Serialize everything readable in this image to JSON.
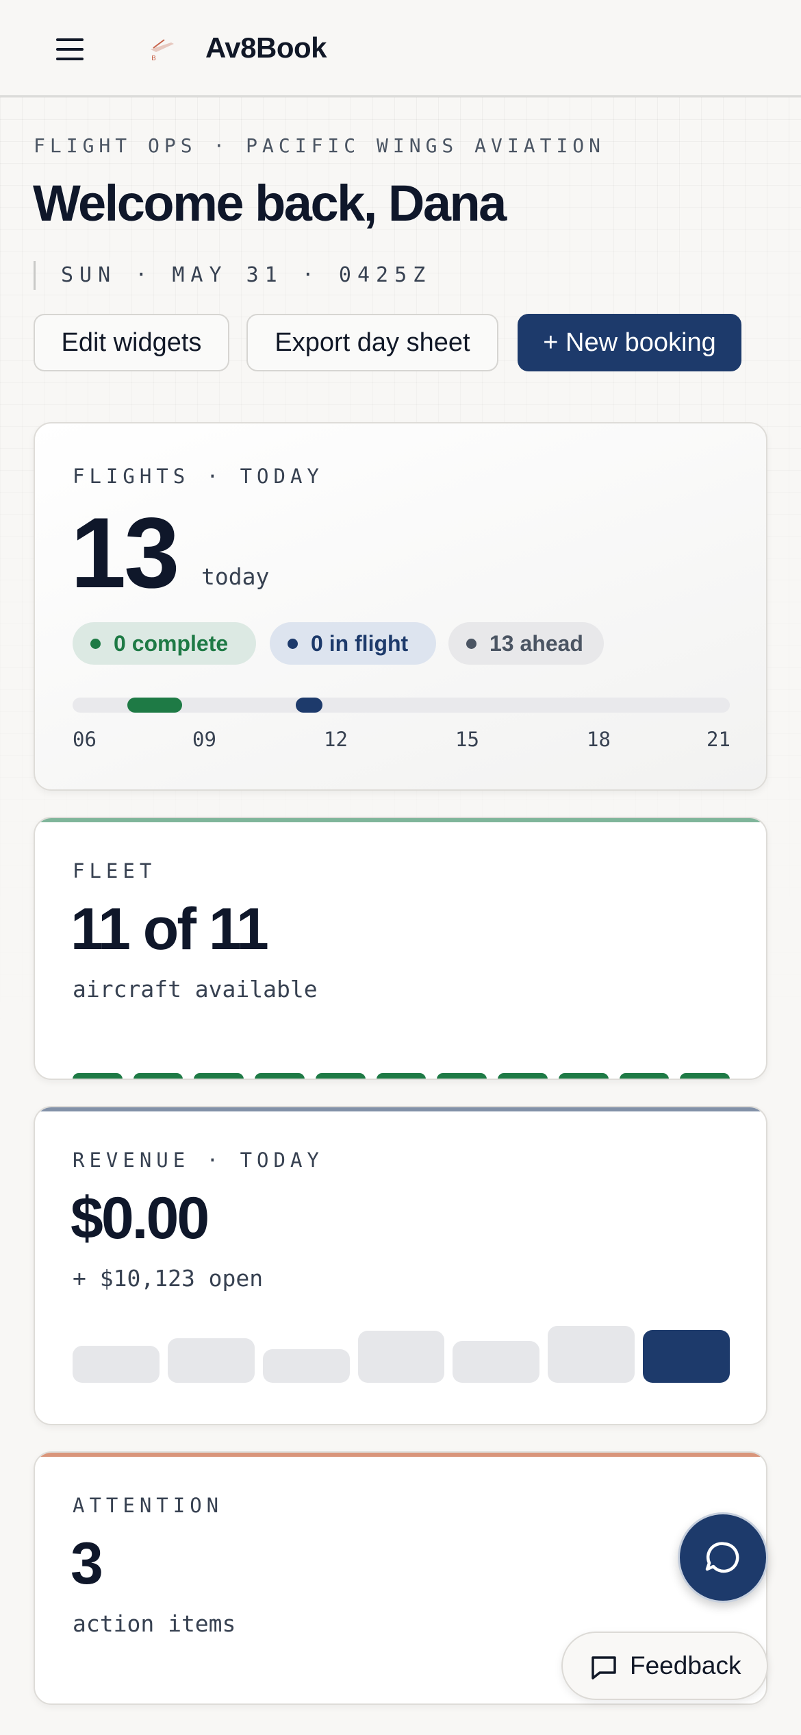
{
  "app": {
    "title": "Av8Book"
  },
  "header": {
    "eyebrow": "FLIGHT OPS · PACIFIC WINGS AVIATION",
    "welcome": "Welcome back, Dana",
    "dateline": "SUN · MAY 31 · 0425Z"
  },
  "actions": {
    "edit_widgets": "Edit widgets",
    "export_day_sheet": "Export day sheet",
    "new_booking": "+ New booking"
  },
  "flights_card": {
    "label": "FLIGHTS · TODAY",
    "count": "13",
    "count_suffix": "today",
    "pills": {
      "complete": "0 complete",
      "in_flight": "0 in flight",
      "ahead": "13 ahead"
    },
    "timeline_ticks": [
      "06",
      "09",
      "12",
      "15",
      "18",
      "21"
    ],
    "timeline_segments": [
      {
        "start_hour": 7.25,
        "end_hour": 8.5,
        "status": "complete"
      },
      {
        "start_hour": 11.1,
        "end_hour": 11.7,
        "status": "in_flight"
      }
    ]
  },
  "fleet_card": {
    "label": "FLEET",
    "value": "11 of 11",
    "sub": "aircraft available",
    "aircraft_available": 11,
    "aircraft_total": 11
  },
  "revenue_card": {
    "label": "REVENUE · TODAY",
    "value": "$0.00",
    "sub": "+ $10,123 open",
    "bars_relative": [
      0.6,
      0.72,
      0.55,
      0.84,
      0.68,
      0.92,
      0.86
    ],
    "highlighted_bar": 6
  },
  "attention_card": {
    "label": "ATTENTION",
    "value": "3",
    "sub": "action items"
  },
  "feedback": {
    "label": "Feedback"
  },
  "colors": {
    "brand_navy": "#1d3a6b",
    "success_green": "#1e7a45",
    "fleet_accent": "#7fb59a",
    "revenue_accent": "#8291a8",
    "attention_accent": "#d9957a"
  },
  "icons": {
    "menu": "hamburger-menu-icon",
    "logo": "airplane-logo-icon",
    "chat": "chat-bubble-icon",
    "feedback": "message-square-icon"
  }
}
